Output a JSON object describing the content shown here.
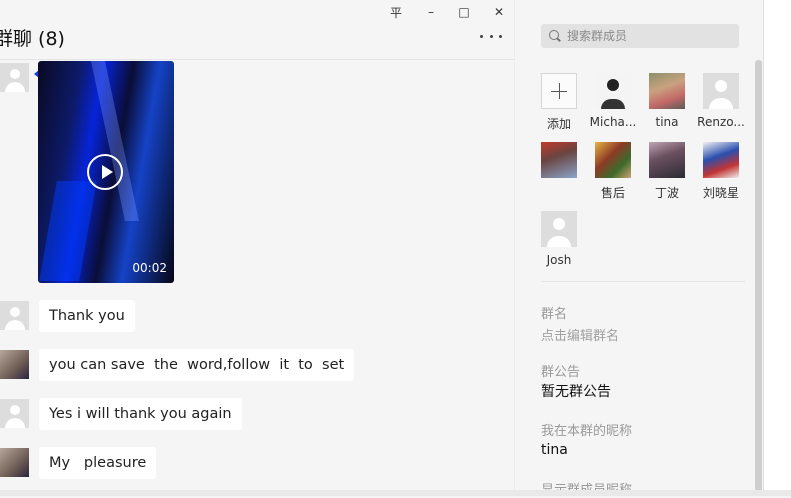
{
  "window": {
    "pin_glyph": "平",
    "minimize_glyph": "–",
    "maximize_glyph": "□",
    "close_glyph": "✕"
  },
  "chat": {
    "title": "群聊 (8)",
    "video": {
      "duration": "00:02"
    },
    "messages": [
      {
        "text": "Thank you"
      },
      {
        "text": "you can save  the  word,follow  it  to  set"
      },
      {
        "text": "Yes i will thank you again"
      },
      {
        "text": "My   pleasure"
      }
    ]
  },
  "sidebar": {
    "search_placeholder": "搜索群成员",
    "members": [
      {
        "name": "添加",
        "icon": "add-icon"
      },
      {
        "name": "Micha..."
      },
      {
        "name": "tina"
      },
      {
        "name": "Renzo..."
      },
      {
        "name": ""
      },
      {
        "name": "售后"
      },
      {
        "name": "丁波"
      },
      {
        "name": "刘晓星"
      },
      {
        "name": "Josh"
      }
    ],
    "group_name_label": "群名",
    "group_name_value": "点击编辑群名",
    "announcement_label": "群公告",
    "announcement_value": "暂无群公告",
    "nickname_label": "我在本群的昵称",
    "nickname_value": "tina",
    "show_nicknames_label": "显示群成员昵称"
  },
  "colors": {
    "background": "#f5f5f5",
    "bubble": "#ffffff",
    "video_accent": "#0624d9"
  }
}
